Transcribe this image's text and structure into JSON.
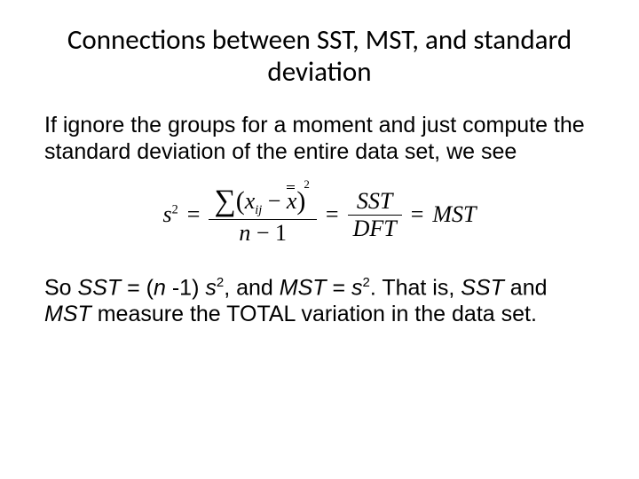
{
  "slide": {
    "title": "Connections between SST, MST, and standard deviation",
    "para1": "If ignore the groups for a moment and just compute the standard deviation of the entire data set, we see",
    "formula": {
      "lhs_base": "s",
      "lhs_exp": "2",
      "eq": "=",
      "frac1": {
        "sigma": "∑",
        "lparen": "(",
        "x": "x",
        "ij": "ij",
        "minus": "−",
        "xbar": "x",
        "rparen": ")",
        "outer_exp": "2",
        "den_n": "n",
        "den_minus": "−",
        "den_one": "1"
      },
      "frac2": {
        "num": "SST",
        "den": "DFT"
      },
      "rhs": "MST"
    },
    "para2_parts": {
      "p1": "So  ",
      "sst": "SST",
      "eq1": " = (",
      "n": "n ",
      "minus1": "-1) ",
      "s": "s",
      "two": "2",
      "comma": ",  and ",
      "mst": "MST",
      "eq2": " = ",
      "s2": "s",
      "two2": "2",
      "period": ".  That is, ",
      "sst2": "SST",
      "and": " and ",
      "mst2": "MST",
      "tail": " measure the TOTAL variation in the data set."
    }
  }
}
